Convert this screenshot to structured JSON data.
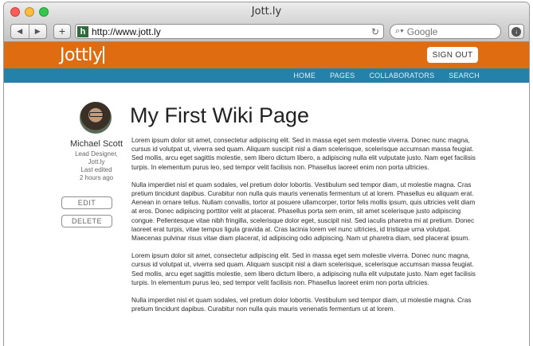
{
  "browser": {
    "window_title": "Jott.ly",
    "back_icon": "back-arrow-icon",
    "forward_icon": "forward-arrow-icon",
    "newtab_label": "+",
    "favicon_letter": "h",
    "url": "http://www.jott.ly",
    "search_placeholder": "Google"
  },
  "site": {
    "logo": "Jottly",
    "signout_label": "SIGN OUT",
    "nav": [
      "HOME",
      "PAGES",
      "COLLABORATORS",
      "SEARCH"
    ],
    "colors": {
      "header": "#e06c12",
      "nav": "#2481aa"
    }
  },
  "author": {
    "name": "Michael Scott",
    "role_line1": "Lead Designer,",
    "role_line2": "Jott.ly",
    "edited_label": "Last edited",
    "edited_time": "2 hours ago"
  },
  "actions": {
    "edit": "EDIT",
    "delete": "DELETE"
  },
  "page": {
    "title": "My First Wiki Page",
    "paragraphs": [
      "Lorem ipsum dolor sit amet, consectetur adipiscing elit. Sed in massa eget sem molestie viverra. Donec nunc magna, cursus id volutpat ut, viverra sed quam. Aliquam suscipit nisl a diam scelerisque, scelerisque accumsan massa feugiat. Sed mollis, arcu eget sagittis molestie, sem libero dictum libero, a adipiscing nulla elit vulputate justo. Nam eget facilisis turpis. In elementum purus leo, sed tempor velit facilisis non. Phasellus laoreet enim non porta ultricies.",
      "Nulla imperdiet nisl et quam sodales, vel pretium dolor lobortis. Vestibulum sed tempor diam, ut molestie magna. Cras pretium tincidunt dapibus. Curabitur non nulla quis mauris venenatis fermentum ut at lorem. Phasellus eu aliquam erat. Aenean in ornare tellus. Nullam convallis, tortor at posuere ullamcorper, tortor felis mollis ipsum, quis ultricies velit diam at eros. Donec adipiscing porttitor velit at placerat. Phasellus porta sem enim, sit amet scelerisque justo adipiscing congue. Pellentesque vitae nibh fringilla, scelerisque dolor eget, suscipit nisl. Sed iaculis pharetra mi at pretium. Donec laoreet erat turpis, vitae tempus ligula gravida at. Cras lacinia lorem vel nunc ultricies, id tristique urna volutpat. Maecenas pulvinar risus vitae diam placerat, id adipiscing odio adipiscing. Nam ut pharetra diam, sed placerat ipsum.",
      "Lorem ipsum dolor sit amet, consectetur adipiscing elit. Sed in massa eget sem molestie viverra. Donec nunc magna, cursus id volutpat ut, viverra sed quam. Aliquam suscipit nisl a diam scelerisque, scelerisque accumsan massa feugiat. Sed mollis, arcu eget sagittis molestie, sem libero dictum libero, a adipiscing nulla elit vulputate justo. Nam eget facilisis turpis. In elementum purus leo, sed tempor velit facilisis non. Phasellus laoreet enim non porta ultricies.",
      "Nulla imperdiet nisl et quam sodales, vel pretium dolor lobortis. Vestibulum sed tempor diam, ut molestie magna. Cras pretium tincidunt dapibus. Curabitur non nulla quis mauris venenatis fermentum ut at lorem."
    ]
  }
}
